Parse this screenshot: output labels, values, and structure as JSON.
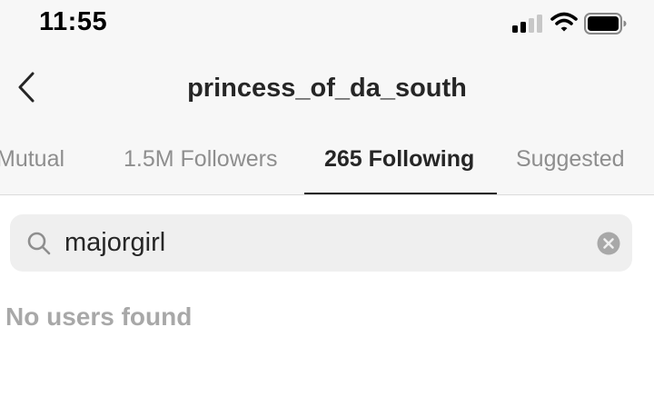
{
  "status_bar": {
    "time": "11:55",
    "icons": [
      "cellular-signal-icon",
      "wifi-icon",
      "battery-icon"
    ]
  },
  "header": {
    "back_icon": "chevron-left-icon",
    "title": "princess_of_da_south"
  },
  "tabs": [
    {
      "label": "Mutual",
      "active": false
    },
    {
      "label": "1.5M Followers",
      "active": false
    },
    {
      "label": "265 Following",
      "active": true
    },
    {
      "label": "Suggested",
      "active": false
    }
  ],
  "search": {
    "value": "majorgirl",
    "icon": "search-icon",
    "clear_icon": "clear-icon"
  },
  "results": {
    "empty_message": "No users found"
  },
  "colors": {
    "header_background": "#f7f7f7",
    "active_text": "#262626",
    "inactive_text": "#8e8e8e",
    "search_background": "#efefef",
    "empty_text": "#a8a8a8"
  }
}
